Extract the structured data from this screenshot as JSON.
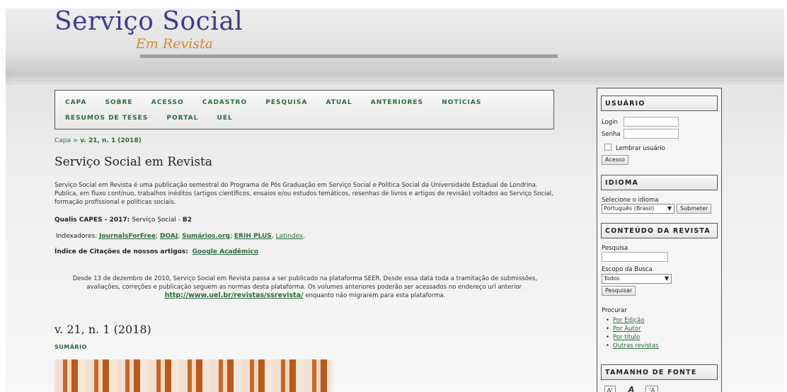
{
  "logo": {
    "main": "Serviço Social",
    "sub": "Em Revista"
  },
  "nav": {
    "row1": [
      "CAPA",
      "SOBRE",
      "ACESSO",
      "CADASTRO",
      "PESQUISA",
      "ATUAL",
      "ANTERIORES",
      "NOTÍCIAS"
    ],
    "row2": [
      "RESUMOS DE TESES",
      "PORTAL",
      "UEL"
    ]
  },
  "breadcrumb": {
    "home": "Capa",
    "sep": " > ",
    "current": "v. 21, n. 1 (2018)"
  },
  "page_title": "Serviço Social em Revista",
  "description": "Serviço Social em Revista é uma publicação semestral do Programa de Pós Graduação em Serviço Social e Política Social da Universidade Estadual de Londrina. Publica, em fluxo contínuo, trabalhos inéditos (artigos científicos, ensaios e/ou estudos temáticos, resenhas de livros e artigos de revisão) voltados ao Serviço Social, formação profissional e políticas sociais.",
  "qualis": {
    "label": "Qualis CAPES - 2017:",
    "area": " Serviço Social - ",
    "grade": "B2"
  },
  "indexers": {
    "label": "Indexadores: ",
    "links": [
      "JournalsForFree",
      "DOAJ",
      "Sumários.org",
      "ERIH PLUS",
      "Latindex"
    ]
  },
  "citations": {
    "label": "Índice de Citações de nossos artigos:",
    "link": "Google Acadêmico"
  },
  "notice": {
    "text": "Desde 13 de dezembro de 2010, Serviço Social em Revista passa a ser publicado na plataforma SEER. Desde essa data toda a tramitação de submissões, avaliações, correções e publicação seguem as normas desta plataforma. Os volumes anteriores poderão ser acessados no endereço url anterior",
    "link": "http://www.uel.br/revistas/ssrevista/",
    "tail": " enquanto não migrarem para esta plataforma."
  },
  "issue": {
    "title": "v. 21, n. 1 (2018)",
    "toc": "SUMÁRIO"
  },
  "sidebar": {
    "user": {
      "title": "USUÁRIO",
      "login_label": "Login",
      "password_label": "Senha",
      "remember_label": "Lembrar usuário",
      "submit": "Acesso"
    },
    "language": {
      "title": "IDIOMA",
      "label": "Selecione o idioma",
      "selected": "Português (Brasil)",
      "submit": "Submeter"
    },
    "journal_content": {
      "title": "CONTEÚDO DA REVISTA",
      "search_label": "Pesquisa",
      "scope_label": "Escopo da Busca",
      "scope_selected": "Todos",
      "search_button": "Pesquisar",
      "browse_label": "Procurar",
      "browse_links": [
        "Por Edição",
        "Por Autor",
        "Por título",
        "Outras revistas"
      ]
    },
    "font_size": {
      "title": "TAMANHO DE FONTE",
      "icons": [
        "font-smaller-icon",
        "font-default-icon",
        "font-larger-icon"
      ]
    }
  }
}
